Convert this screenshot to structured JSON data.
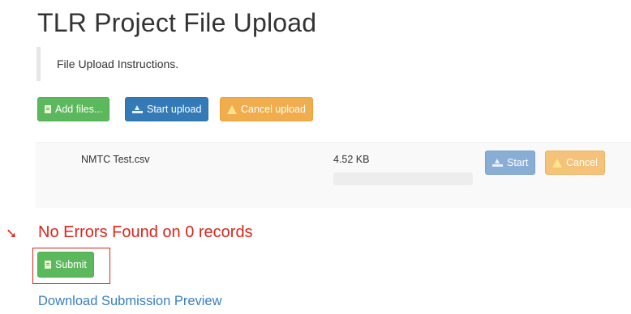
{
  "page": {
    "title": "TLR Project File Upload"
  },
  "instructions": {
    "text": "File Upload Instructions."
  },
  "toolbar": {
    "add_files_label": "Add files...",
    "start_upload_label": "Start upload",
    "cancel_upload_label": "Cancel upload"
  },
  "file": {
    "name": "NMTC Test.csv",
    "size": "4.52 KB",
    "progress": 0,
    "start_label": "Start",
    "cancel_label": "Cancel"
  },
  "result": {
    "arrow": "➘",
    "message": "No Errors Found on 0 records",
    "submit_label": "Submit"
  },
  "download_link": "Download Submission Preview",
  "colors": {
    "success": "#5cb85c",
    "primary": "#337ab7",
    "warning": "#f0ad4e",
    "error_text": "#d9261c",
    "link": "#3a7fc1"
  }
}
